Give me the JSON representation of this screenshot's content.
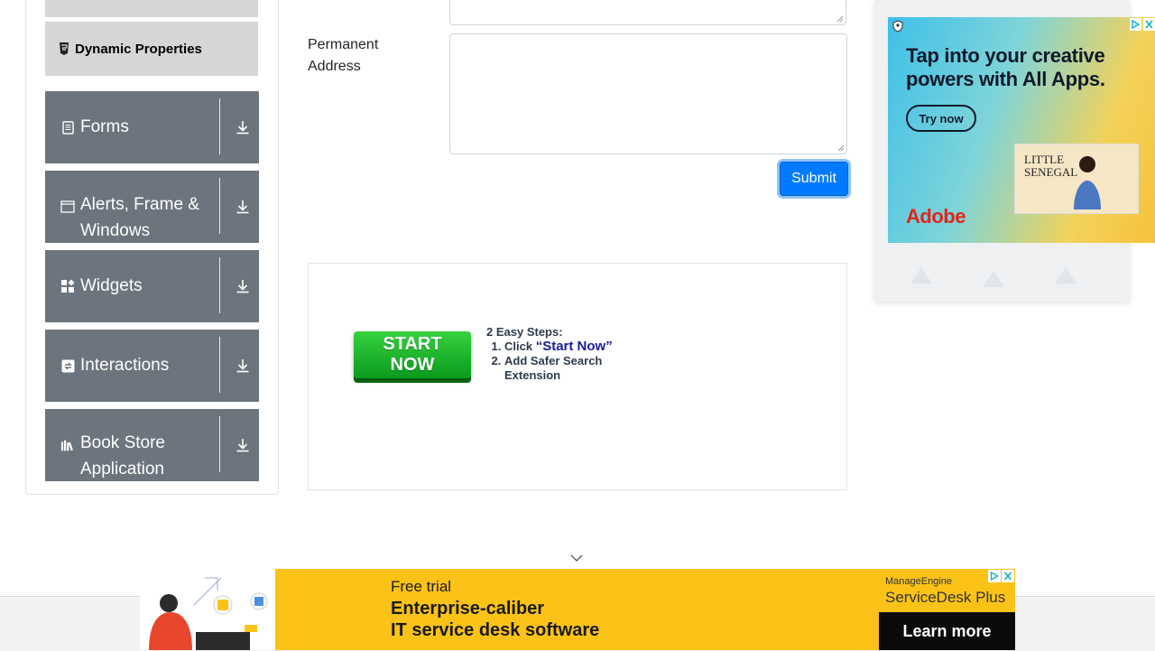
{
  "sidebar": {
    "dynamic_properties": "Dynamic Properties",
    "groups": [
      {
        "label": "Forms",
        "icon": "form-icon"
      },
      {
        "label": "Alerts, Frame & Windows",
        "icon": "window-icon"
      },
      {
        "label": "Widgets",
        "icon": "widgets-icon"
      },
      {
        "label": "Interactions",
        "icon": "interactions-icon"
      },
      {
        "label": "Book Store Application",
        "icon": "book-icon"
      }
    ]
  },
  "form": {
    "permanent_address_label": "Permanent Address",
    "submit_label": "Submit"
  },
  "inline_ad": {
    "button_line1": "START",
    "button_line2": "NOW",
    "steps_title": "2 Easy Steps:",
    "step1_prefix": "Click",
    "step1_highlight": "“Start Now”",
    "step2": "Add Safer Search Extension"
  },
  "right_ad": {
    "headline": "Tap into your creative powers with All Apps.",
    "cta": "Try now",
    "brand": "Adobe",
    "poster_line1": "LITTLE",
    "poster_line2": "SENEGAL"
  },
  "bottom_ad": {
    "line1": "Free trial",
    "line2": "Enterprise-caliber",
    "line3": "IT service desk software",
    "brand_small": "ManageEngine",
    "brand_product": "ServiceDesk Plus",
    "cta": "Learn more"
  },
  "colors": {
    "group_bg": "#6c757d",
    "submit_blue": "#007bff",
    "start_green": "#17b427",
    "adobe_red": "#e1251b",
    "manageengine_yellow": "#fbc217"
  }
}
